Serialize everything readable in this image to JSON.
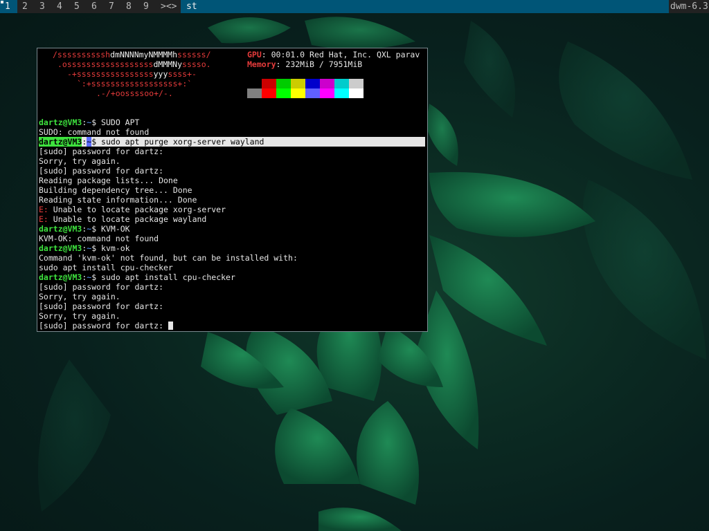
{
  "bar": {
    "tags": [
      "1",
      "2",
      "3",
      "4",
      "5",
      "6",
      "7",
      "8",
      "9"
    ],
    "active_tag": "1",
    "layout": "><>",
    "title": "st",
    "status": "dwm-6.3",
    "colors": {
      "bar_bg": "#222222",
      "selected_bg": "#005577",
      "text": "#bbbbbb",
      "selected_text": "#eeeeee"
    }
  },
  "terminal": {
    "logo": {
      "line1_a": "/ssssssssssh",
      "line1_b": "dmNNNNmyNMMMMh",
      "line1_c": "ssssss/",
      "line2_a": ".ossssssssssssssssss",
      "line2_b": "dMMMNy",
      "line2_c": "sssso.",
      "line3_a": "-+ssssssssssssssss",
      "line3_b": "yyy",
      "line3_c": "ssss+-",
      "line4": "`:+ssssssssssssssssss+:`",
      "line5": ".-/+oossssoo+/-."
    },
    "info": {
      "gpu_label": "GPU",
      "gpu_value": ": 00:01.0 Red Hat, Inc. QXL parav",
      "memory_label": "Memory",
      "memory_value": ": 232MiB / 7951MiB"
    },
    "palette": {
      "top": [
        "#000000",
        "#cc0000",
        "#00cc00",
        "#cccc00",
        "#0000cc",
        "#cc00cc",
        "#00cccc",
        "#cccccc"
      ],
      "bottom": [
        "#808080",
        "#ff0000",
        "#00ff00",
        "#ffff00",
        "#6060ff",
        "#ff00ff",
        "#00ffff",
        "#ffffff"
      ]
    },
    "prompt": {
      "user_host": "dartz@VM3",
      "colon": ":",
      "path": "~",
      "symbol": "$"
    },
    "lines": {
      "l01_cmd": " SUDO APT",
      "l02": "SUDO: command not found",
      "l03_cmd": " sudo apt purge xorg-server wayland",
      "l04": "[sudo] password for dartz:",
      "l05": "Sorry, try again.",
      "l06": "[sudo] password for dartz:",
      "l07": "Reading package lists... Done",
      "l08": "Building dependency tree... Done",
      "l09": "Reading state information... Done",
      "l10_e": "E:",
      "l10": " Unable to locate package xorg-server",
      "l11_e": "E:",
      "l11": " Unable to locate package wayland",
      "l12_cmd": " KVM-OK",
      "l13": "KVM-OK: command not found",
      "l14_cmd": " kvm-ok",
      "l15": "Command 'kvm-ok' not found, but can be installed with:",
      "l16": "sudo apt install cpu-checker",
      "l17_cmd": " sudo apt install cpu-checker",
      "l18": "[sudo] password for dartz:",
      "l19": "Sorry, try again.",
      "l20": "[sudo] password for dartz:",
      "l21": "Sorry, try again.",
      "l22": "[sudo] password for dartz: "
    }
  }
}
